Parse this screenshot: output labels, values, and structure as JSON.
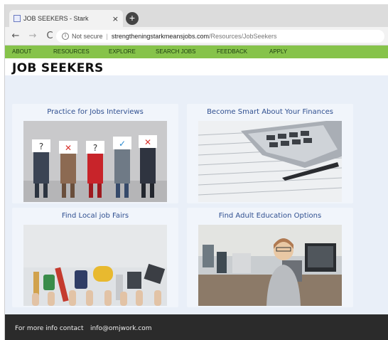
{
  "browser": {
    "tab_title": "JOB SEEKERS - Stark",
    "tab_close": "×",
    "new_tab": "+",
    "back": "←",
    "forward": "→",
    "reload": "C",
    "security": "Not secure",
    "url_host": "strengtheningstarkmeansjobs.com",
    "url_path": "/Resources/JobSeekers"
  },
  "nav": {
    "items": [
      "ABOUT",
      "RESOURCES",
      "EXPLORE",
      "SEARCH JOBS",
      "FEEDBACK",
      "APPLY"
    ]
  },
  "page": {
    "title": "JOB SEEKERS"
  },
  "cards": [
    {
      "title": "Practice for Jobs Interviews"
    },
    {
      "title": "Become Smart About Your Finances"
    },
    {
      "title": "Find Local job Fairs"
    },
    {
      "title": "Find Adult Education Options"
    }
  ],
  "footer": {
    "text": "For more info contact",
    "email": "info@omjwork.com"
  },
  "colors": {
    "nav_green": "#86c34a",
    "card_title": "#2f4f90",
    "footer_bg": "#2b2b2b"
  }
}
